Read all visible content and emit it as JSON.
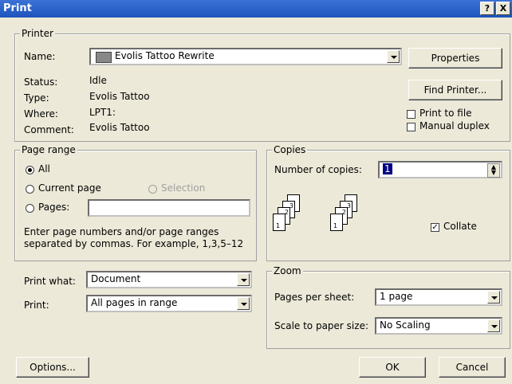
{
  "window": {
    "title": "Print",
    "help_btn": "?",
    "close_btn": "X"
  },
  "printer": {
    "legend": "Printer",
    "name_label": "Name:",
    "name_value": "Evolis Tattoo Rewrite",
    "properties_btn": "Properties",
    "find_printer_btn": "Find Printer...",
    "status_label": "Status:",
    "status_value": "Idle",
    "type_label": "Type:",
    "type_value": "Evolis Tattoo",
    "where_label": "Where:",
    "where_value": "LPT1:",
    "comment_label": "Comment:",
    "comment_value": "Evolis Tattoo",
    "print_to_file": "Print to file",
    "manual_duplex": "Manual duplex",
    "print_to_file_checked": false,
    "manual_duplex_checked": false
  },
  "page_range": {
    "legend": "Page range",
    "all": "All",
    "current_page": "Current page",
    "selection": "Selection",
    "pages": "Pages:",
    "pages_value": "",
    "help_line1": "Enter page numbers and/or page ranges",
    "help_line2": "separated by commas.  For example, 1,3,5–12",
    "selected": "all"
  },
  "copies": {
    "legend": "Copies",
    "number_label": "Number of copies:",
    "number_value": "1",
    "collate": "Collate",
    "collate_checked": true,
    "page_labels": [
      "3",
      "2",
      "1"
    ]
  },
  "print_what": {
    "label": "Print what:",
    "value": "Document"
  },
  "print_sel": {
    "label": "Print:",
    "value": "All pages in range"
  },
  "zoom": {
    "legend": "Zoom",
    "pages_per_sheet_label": "Pages per sheet:",
    "pages_per_sheet_value": "1 page",
    "scale_label": "Scale to paper size:",
    "scale_value": "No Scaling"
  },
  "footer": {
    "options_btn": "Options...",
    "ok_btn": "OK",
    "cancel_btn": "Cancel"
  }
}
